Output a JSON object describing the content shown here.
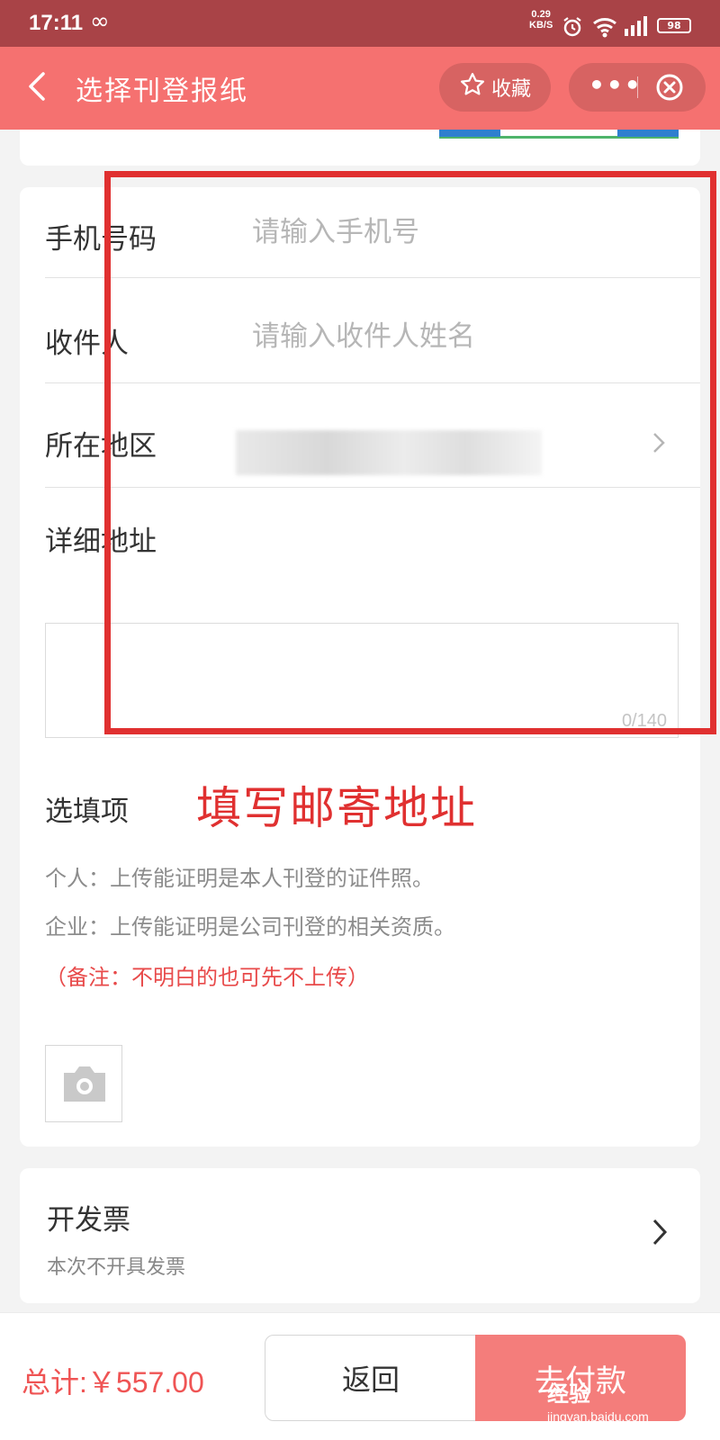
{
  "status_bar": {
    "time": "17:11",
    "loop_glyph": "∞",
    "net_speed_value": "0.29",
    "net_speed_unit": "KB/S",
    "battery": "98"
  },
  "nav": {
    "title": "选择刊登报纸",
    "favorite_label": "收藏",
    "more_glyph": "•••",
    "theme_color": "#f57170"
  },
  "form": {
    "phone": {
      "label": "手机号码",
      "placeholder": "请输入手机号"
    },
    "recipient": {
      "label": "收件人",
      "placeholder": "请输入收件人姓名"
    },
    "region": {
      "label": "所在地区"
    },
    "address": {
      "label": "详细地址",
      "counter": "0/140"
    },
    "optional": {
      "label": "选填项",
      "hint_personal": "个人：上传能证明是本人刊登的证件照。",
      "hint_company": "企业：上传能证明是公司刊登的相关资质。",
      "note": "（备注：不明白的也可先不上传）"
    }
  },
  "annotation": {
    "text": "填写邮寄地址",
    "color": "#e03030"
  },
  "invoice": {
    "title": "开发票",
    "subtitle": "本次不开具发票"
  },
  "footer": {
    "total": "总计:￥557.00",
    "back_label": "返回",
    "pay_label": "去付款",
    "watermark_text": "经验",
    "watermark_url": "jingyan.baidu.com"
  }
}
